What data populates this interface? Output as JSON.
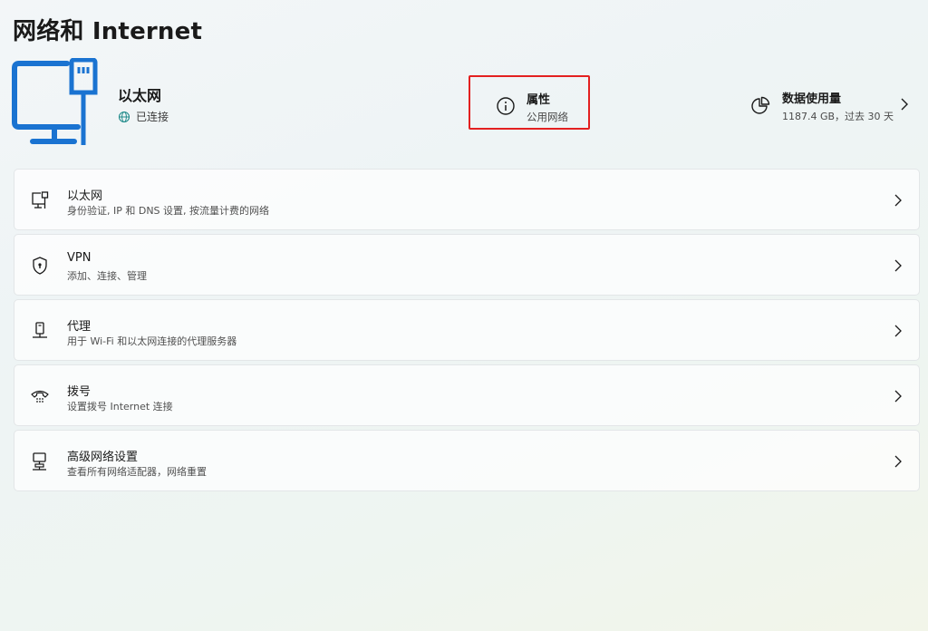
{
  "page": {
    "title": "网络和 Internet"
  },
  "hero": {
    "adapter_name": "以太网",
    "status": "已连接",
    "adapter_icon": "ethernet-monitor-icon",
    "status_icon": "globe-icon",
    "accent_color": "#1a73d1"
  },
  "properties": {
    "title": "属性",
    "subtitle": "公用网络",
    "icon": "info-icon",
    "highlight_color": "#e32020"
  },
  "data_usage": {
    "title": "数据使用量",
    "subtitle": "1187.4 GB，过去 30 天",
    "icon": "pie-chart-icon"
  },
  "settings_list": [
    {
      "title": "以太网",
      "subtitle": "身份验证, IP 和 DNS 设置, 按流量计费的网络",
      "icon": "ethernet-icon"
    },
    {
      "title": "VPN",
      "subtitle": "添加、连接、管理",
      "icon": "shield-icon"
    },
    {
      "title": "代理",
      "subtitle": "用于 Wi-Fi 和以太网连接的代理服务器",
      "icon": "proxy-icon"
    },
    {
      "title": "拨号",
      "subtitle": "设置拨号 Internet 连接",
      "icon": "dialup-phone-icon"
    },
    {
      "title": "高级网络设置",
      "subtitle": "查看所有网络适配器，网络重置",
      "icon": "network-adapter-icon"
    }
  ]
}
